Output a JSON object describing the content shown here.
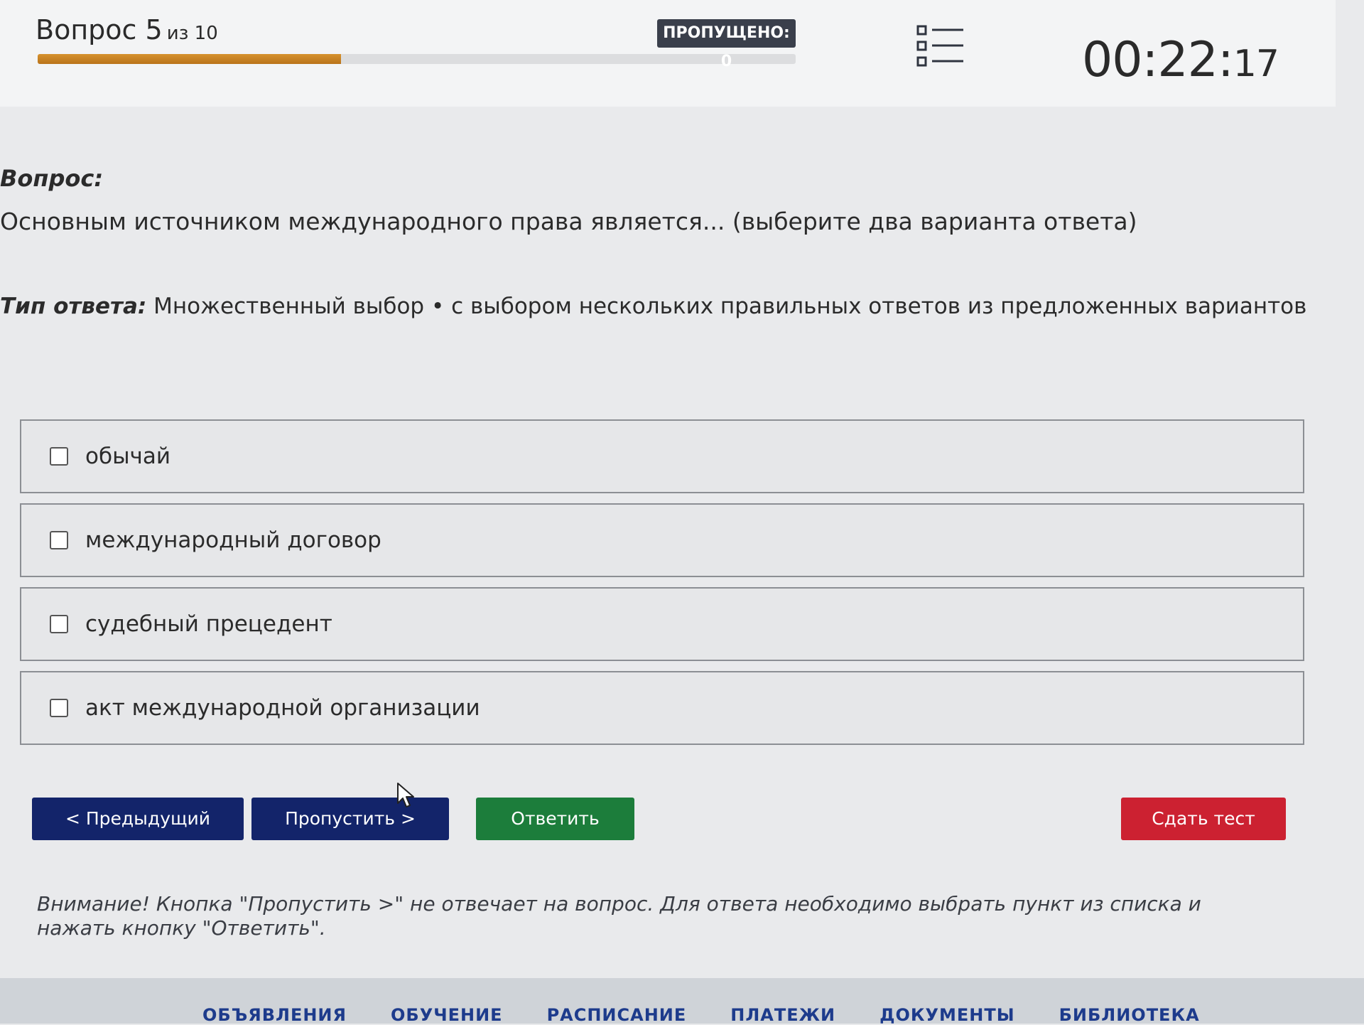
{
  "header": {
    "question_prefix": "Вопрос 5",
    "question_of": "из 10",
    "progress_fraction": 0.4,
    "skipped_label": "ПРОПУЩЕНО: 0",
    "list_icon": "question-list-icon",
    "timer_main": "00:22:",
    "timer_seconds": "17"
  },
  "question": {
    "label": "Вопрос:",
    "text": "Основным источником международного права является... (выберите два варианта ответа)",
    "answer_type_label": "Тип ответа:",
    "answer_type_value": "Множественный выбор • с выбором нескольких правильных ответов из предложенных вариантов"
  },
  "options": [
    {
      "label": "обычай",
      "checked": false
    },
    {
      "label": "международный договор",
      "checked": false
    },
    {
      "label": "судебный прецедент",
      "checked": false
    },
    {
      "label": "акт международной организации",
      "checked": false
    }
  ],
  "buttons": {
    "prev": "< Предыдущий",
    "skip": "Пропустить >",
    "answer": "Ответить",
    "submit": "Сдать тест"
  },
  "warning": "Внимание! Кнопка \"Пропустить >\" не отвечает на вопрос. Для ответа необходимо выбрать пункт из списка и нажать кнопку \"Ответить\".",
  "footer_nav": [
    "ОБЪЯВЛЕНИЯ",
    "ОБУЧЕНИЕ",
    "РАСПИСАНИЕ",
    "ПЛАТЕЖИ",
    "ДОКУМЕНТЫ",
    "БИБЛИОТЕКА"
  ],
  "colors": {
    "progress": "#c98324",
    "nav_button": "#13246a",
    "answer_button": "#1c7d3b",
    "submit_button": "#cc2131",
    "badge": "#3a3f4b"
  }
}
